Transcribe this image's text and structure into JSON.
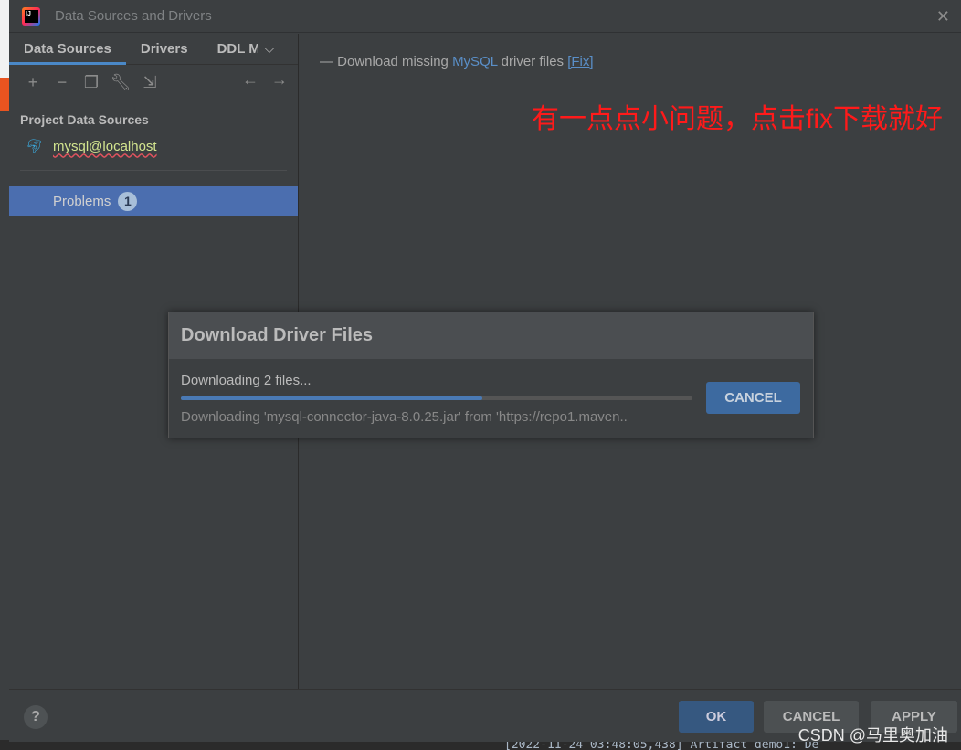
{
  "window": {
    "title": "Data Sources and Drivers"
  },
  "tabs": [
    {
      "label": "Data Sources"
    },
    {
      "label": "Drivers"
    },
    {
      "label": "DDL Mappings"
    }
  ],
  "sidebar": {
    "section": "Project Data Sources",
    "datasource": "mysql@localhost",
    "problems_label": "Problems",
    "problems_count": "1"
  },
  "main": {
    "message_prefix": "— Download missing ",
    "message_db": "MySQL",
    "message_suffix": " driver files ",
    "fix_link": "[Fix]",
    "annotation": "有一点点小问题，点击fix下载就好"
  },
  "popup": {
    "title": "Download Driver Files",
    "status": "Downloading 2 files...",
    "progress_percent": 59,
    "detail": "Downloading 'mysql-connector-java-8.0.25.jar' from 'https://repo1.maven..",
    "cancel": "CANCEL"
  },
  "footer": {
    "help": "?",
    "ok": "OK",
    "cancel": "CANCEL",
    "apply": "APPLY"
  },
  "watermark": "CSDN @马里奥加油",
  "console": "[2022-11-24 03:48:05,438] Artifact demo1: De",
  "colors": {
    "accent": "#4a88c7",
    "selection": "#4b6eaf",
    "annotation": "#ff1a1a"
  }
}
